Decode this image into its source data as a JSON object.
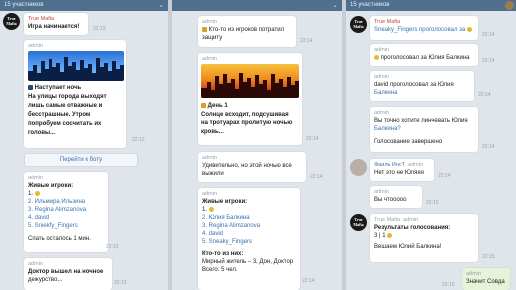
{
  "panel1": {
    "topbar": "15 участников",
    "m1": {
      "sender": "True Mafia",
      "text": "Игра начинается!",
      "time": "22:13"
    },
    "m2": {
      "sender": "admin",
      "lines": [
        "Наступает ночь",
        "На улицы города выходят",
        "лишь самые отважные и",
        "бесстрашные. Утром",
        "попробуем сосчитать их",
        "головы..."
      ],
      "time": "22:13"
    },
    "button": "Перейти к боту",
    "m3": {
      "sender": "admin",
      "title": "Живые игроки:",
      "players": [
        "1.",
        "2. Ильмира Ильзина",
        "3. Regina Alimzanova",
        "4. david",
        "5. Sniekfy_Fingers"
      ],
      "footer": "Спать осталось 1 мин.",
      "time": "22:13"
    },
    "m4": {
      "sender": "admin",
      "lines": [
        "Доктор вышел на ночное",
        "дежурство..."
      ],
      "time": "22:13"
    }
  },
  "panel2": {
    "m1": {
      "sender": "admin",
      "lines": [
        "Кто-то из игроков потратил",
        "защиту"
      ],
      "time": "22:14"
    },
    "m2": {
      "sender": "admin",
      "lines": [
        "День 1",
        "Солнце всходит, подсушивая",
        "на тротуарах пролитую ночью",
        "кровь..."
      ],
      "time": "22:14"
    },
    "m3": {
      "sender": "admin",
      "lines": [
        "Удивительно, но этой ночью все",
        "выжили"
      ],
      "time": "22:14"
    },
    "m4": {
      "sender": "admin",
      "title": "Живые игроки:",
      "players": [
        "1.",
        "2. Юлия Балкина",
        "3. Regina Alimzanova",
        "4. david",
        "5. Sneaky_Fingers"
      ],
      "section": "Кто-то из них:",
      "roles": "Мирный житель – 3, Дон, Доктор",
      "total": "Всего: 5 чел.",
      "time": "22:14"
    }
  },
  "panel3": {
    "topbar": "15 участников",
    "m1": {
      "sender": "True Mafia",
      "line1": "Sneaky_Fingers проголосовал за",
      "time": "22:14"
    },
    "m2": {
      "sender": "admin",
      "text": "проголосовал за Юлия Балкина",
      "time": "22:14"
    },
    "m3": {
      "sender": "admin",
      "text1": "david проголосовал за Юлия",
      "text2": "Балкина",
      "time": "22:14"
    },
    "m4": {
      "sender": "admin",
      "lines": [
        "Вы точно хотите линчевать Юлия",
        "Балкина?"
      ],
      "footer": "Голосование завершено",
      "time": "22:14"
    },
    "m5": {
      "sender": "Фаиль ИнсТ",
      "sub": "admin",
      "text": "Нет это не Юляяя",
      "time": "22:14"
    },
    "m6": {
      "sender": "admin",
      "text": "Вы чтооооо",
      "time": "22:15"
    },
    "m7": {
      "sender": "True Mafia",
      "sub": "admin",
      "title": "Результаты голосования:",
      "counts": "3 | 1",
      "result": "Вешаем Юлий Балкина!",
      "time": "22:15"
    },
    "m8": {
      "sender": "admin",
      "text": "Значит Совда",
      "time": "22:15"
    }
  }
}
